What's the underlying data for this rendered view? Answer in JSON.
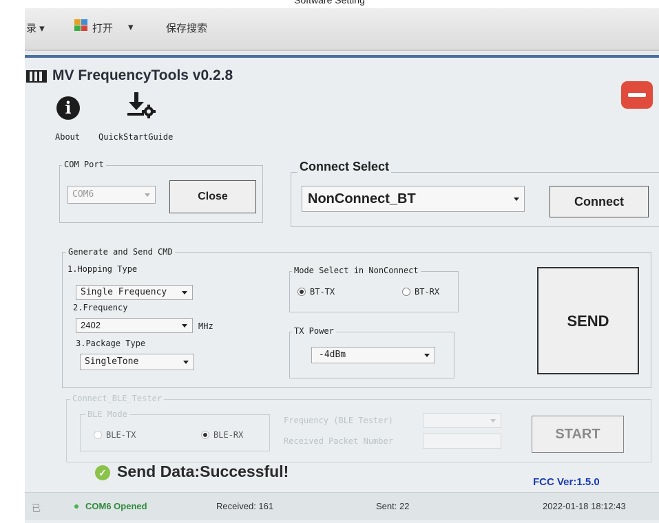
{
  "caption": "Software Setting",
  "toolbar": {
    "item_left": "录 ▾",
    "open_label": "打开",
    "open_caret": "▾",
    "save_search_label": "保存搜索"
  },
  "app": {
    "title": "MV FrequencyTools v0.2.8",
    "about_label": "About",
    "quickstart_label": "QuickStartGuide",
    "info_icon_glyph": "i"
  },
  "com_port": {
    "legend": "COM Port",
    "selected": "COM6",
    "close_button": "Close"
  },
  "connect_select": {
    "legend": "Connect Select",
    "selected": "NonConnect_BT",
    "connect_button": "Connect"
  },
  "generate": {
    "legend": "Generate and Send CMD",
    "hopping_label": "1.Hopping Type",
    "hopping_value": "Single Frequency",
    "frequency_label": "2.Frequency",
    "frequency_value": "2402",
    "frequency_unit": "MHz",
    "package_label": "3.Package Type",
    "package_value": "SingleTone",
    "mode_legend": "Mode Select in NonConnect",
    "bt_tx": "BT-TX",
    "bt_rx": "BT-RX",
    "tx_power_legend": "TX Power",
    "tx_power_value": "-4dBm",
    "send_button": "SEND"
  },
  "ble_tester": {
    "legend": "Connect_BLE_Tester",
    "ble_mode_legend": "BLE Mode",
    "ble_tx": "BLE-TX",
    "ble_rx": "BLE-RX",
    "frequency_label": "Frequency (BLE Tester)",
    "received_label": "Received Packet Number",
    "start_button": "START"
  },
  "result": {
    "message": "Send Data:Successful!",
    "fcc_version": "FCC Ver:1.5.0"
  },
  "statusbar": {
    "left_glyph": "已",
    "com_status": "COM6 Opened",
    "received": "Received: 161",
    "sent": "Sent: 22",
    "datetime": "2022-01-18 18:12:43"
  },
  "colors": {
    "title_bar_accent": "#4a6fa0",
    "close_red": "#e14b3b",
    "success_green": "#8bc34a",
    "fcc_blue": "#1a3bb0",
    "status_green": "#2e8b3d"
  }
}
